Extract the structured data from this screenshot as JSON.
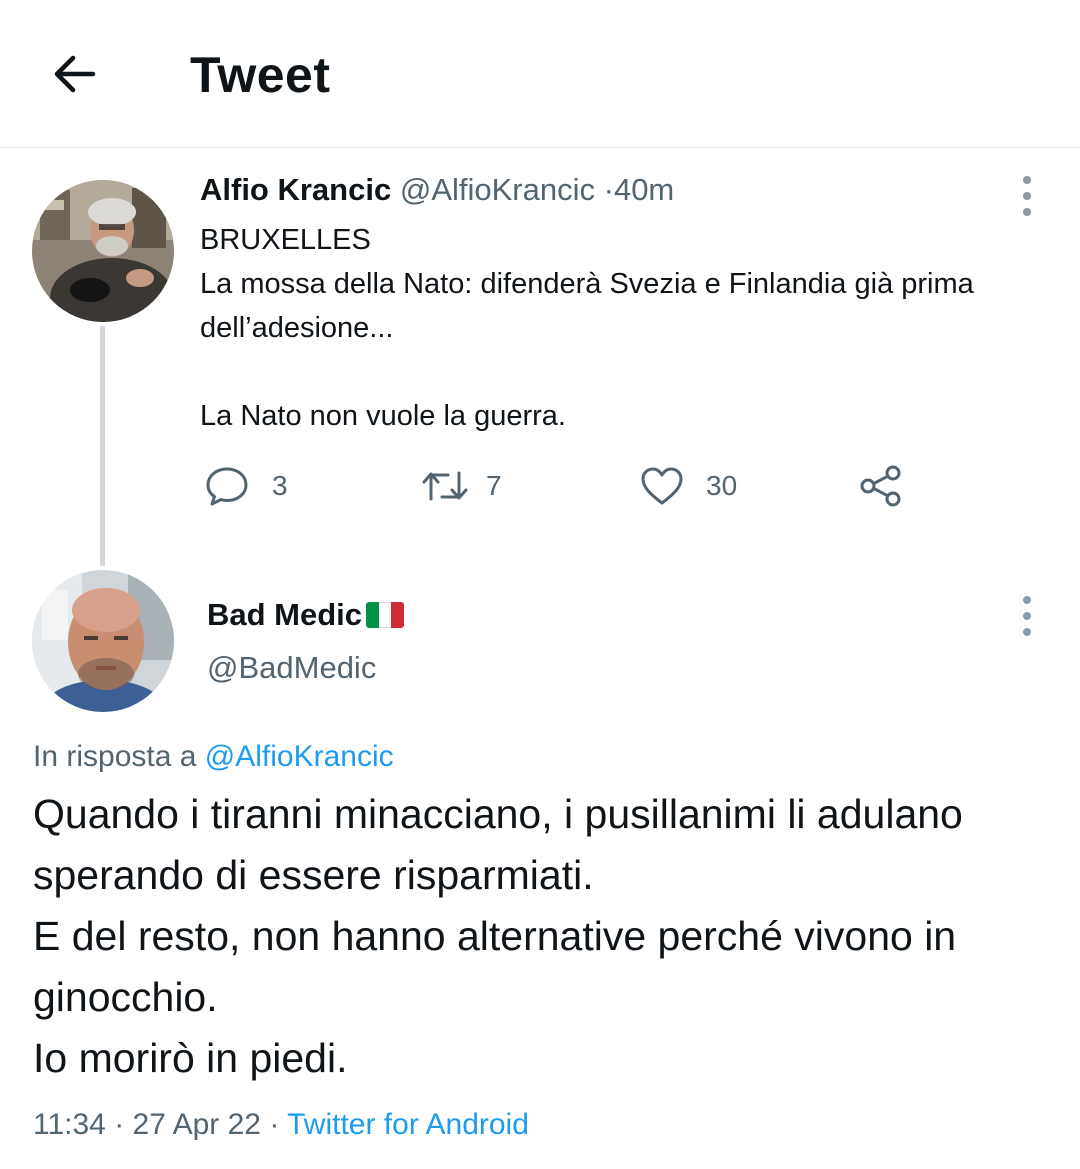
{
  "header": {
    "title": "Tweet",
    "back_icon": "arrow-left-icon"
  },
  "tweet": {
    "author_name": "Alfio Krancic",
    "author_handle": "@AlfioKrancic",
    "separator": "·",
    "time": "40m",
    "lines": [
      "BRUXELLES",
      "La mossa della Nato: difenderà Svezia e Finlandia già prima dell’adesione...",
      "",
      "La Nato non vuole la guerra."
    ],
    "actions": {
      "replies": "3",
      "retweets": "7",
      "likes": "30"
    }
  },
  "reply": {
    "author_name": "Bad Medic",
    "author_flag": "italy-flag",
    "author_handle": "@BadMedic",
    "reply_prefix": "In risposta a",
    "reply_target": "@AlfioKrancic",
    "lines": [
      "Quando i tiranni minacciano, i pusillanimi li adulano sperando di essere risparmiati.",
      "E del resto, non hanno alternative perché vivono in ginocchio.",
      "Io morirò in piedi."
    ],
    "time": "11:34",
    "date": "27 Apr 22",
    "separator": "·",
    "source": "Twitter for Android"
  },
  "colors": {
    "text": "#0f1419",
    "secondary": "#536471",
    "link": "#1d9bf0",
    "thread_line": "#d3d8dc",
    "flag_green": "#009246",
    "flag_white": "#ffffff",
    "flag_red": "#ce2b37"
  }
}
